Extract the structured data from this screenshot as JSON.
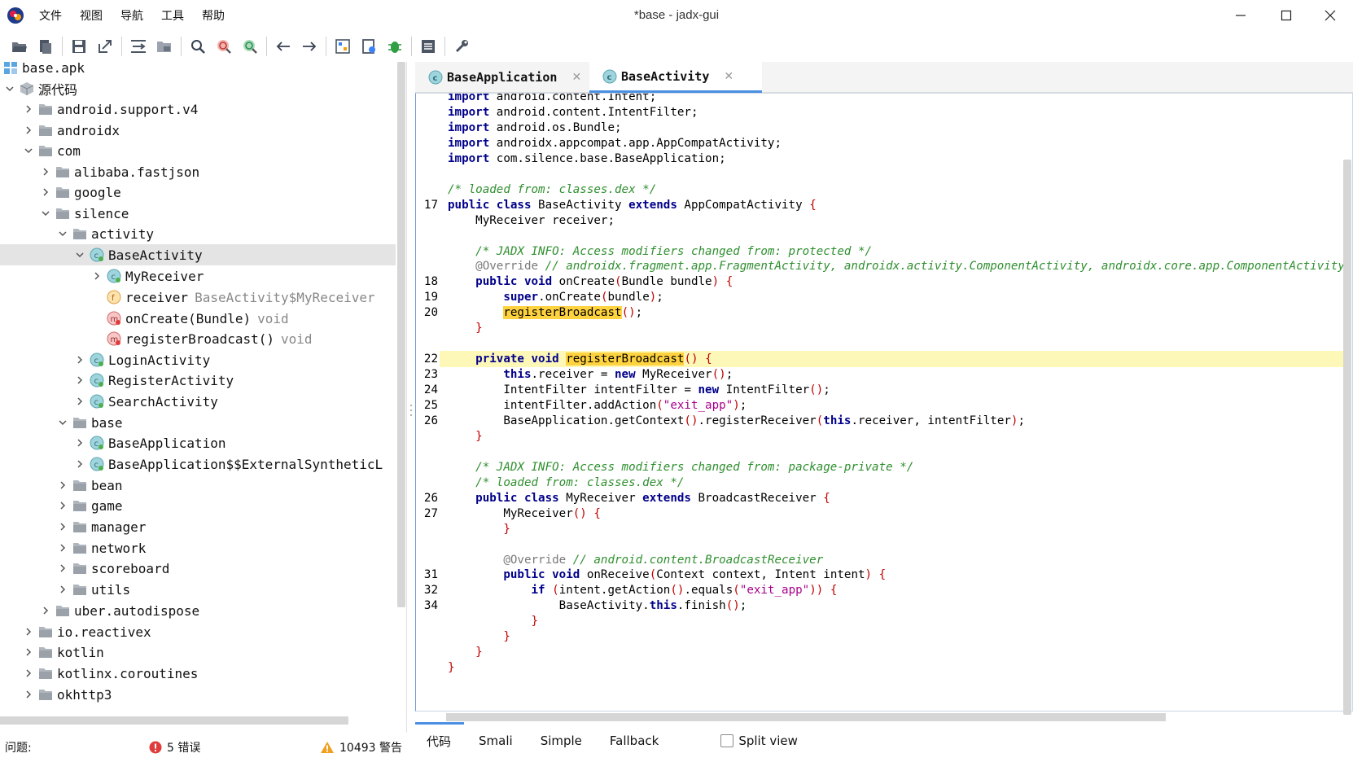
{
  "window": {
    "title": "*base - jadx-gui"
  },
  "menu": [
    "文件",
    "视图",
    "导航",
    "工具",
    "帮助"
  ],
  "toolbar_icons": [
    "open-folder-icon",
    "add-files-icon",
    "save-icon",
    "export-icon",
    "sync-tree-icon",
    "flatten-packages-icon",
    "search-icon",
    "class-search-icon",
    "usage-search-icon",
    "back-icon",
    "forward-icon",
    "deobfuscation-icon",
    "quark-icon",
    "debug-icon",
    "log-icon",
    "preferences-icon"
  ],
  "tree": {
    "rows": [
      {
        "label": "base.apk",
        "suffix": "",
        "icon": "apk",
        "level": 0,
        "chev": "none"
      },
      {
        "label": "源代码",
        "suffix": "",
        "icon": "box",
        "level": 0,
        "chev": "down"
      },
      {
        "label": "android.support.v4",
        "suffix": "",
        "icon": "folder",
        "level": 1,
        "chev": "right"
      },
      {
        "label": "androidx",
        "suffix": "",
        "icon": "folder",
        "level": 1,
        "chev": "right"
      },
      {
        "label": "com",
        "suffix": "",
        "icon": "folder",
        "level": 1,
        "chev": "down"
      },
      {
        "label": "alibaba.fastjson",
        "suffix": "",
        "icon": "folder",
        "level": 2,
        "chev": "right"
      },
      {
        "label": "google",
        "suffix": "",
        "icon": "folder",
        "level": 2,
        "chev": "right"
      },
      {
        "label": "silence",
        "suffix": "",
        "icon": "folder",
        "level": 2,
        "chev": "down"
      },
      {
        "label": "activity",
        "suffix": "",
        "icon": "folder",
        "level": 3,
        "chev": "down"
      },
      {
        "label": "BaseActivity",
        "suffix": "",
        "icon": "class",
        "level": 4,
        "chev": "down",
        "selected": true
      },
      {
        "label": "MyReceiver",
        "suffix": "",
        "icon": "class",
        "level": 5,
        "chev": "right"
      },
      {
        "label": "receiver",
        "suffix": "BaseActivity$MyReceiver",
        "icon": "field",
        "level": 5,
        "chev": "none"
      },
      {
        "label": "onCreate(Bundle)",
        "suffix": "void",
        "icon": "method",
        "level": 5,
        "chev": "none"
      },
      {
        "label": "registerBroadcast()",
        "suffix": "void",
        "icon": "method",
        "level": 5,
        "chev": "none"
      },
      {
        "label": "LoginActivity",
        "suffix": "",
        "icon": "class",
        "level": 4,
        "chev": "right"
      },
      {
        "label": "RegisterActivity",
        "suffix": "",
        "icon": "class",
        "level": 4,
        "chev": "right"
      },
      {
        "label": "SearchActivity",
        "suffix": "",
        "icon": "class",
        "level": 4,
        "chev": "right"
      },
      {
        "label": "base",
        "suffix": "",
        "icon": "folder",
        "level": 3,
        "chev": "down"
      },
      {
        "label": "BaseApplication",
        "suffix": "",
        "icon": "class",
        "level": 4,
        "chev": "right"
      },
      {
        "label": "BaseApplication$$ExternalSyntheticL",
        "suffix": "",
        "icon": "class",
        "level": 4,
        "chev": "right"
      },
      {
        "label": "bean",
        "suffix": "",
        "icon": "folder",
        "level": 3,
        "chev": "right"
      },
      {
        "label": "game",
        "suffix": "",
        "icon": "folder",
        "level": 3,
        "chev": "right"
      },
      {
        "label": "manager",
        "suffix": "",
        "icon": "folder",
        "level": 3,
        "chev": "right"
      },
      {
        "label": "network",
        "suffix": "",
        "icon": "folder",
        "level": 3,
        "chev": "right"
      },
      {
        "label": "scoreboard",
        "suffix": "",
        "icon": "folder",
        "level": 3,
        "chev": "right"
      },
      {
        "label": "utils",
        "suffix": "",
        "icon": "folder",
        "level": 3,
        "chev": "right"
      },
      {
        "label": "uber.autodispose",
        "suffix": "",
        "icon": "folder",
        "level": 2,
        "chev": "right"
      },
      {
        "label": "io.reactivex",
        "suffix": "",
        "icon": "folder",
        "level": 1,
        "chev": "right"
      },
      {
        "label": "kotlin",
        "suffix": "",
        "icon": "folder",
        "level": 1,
        "chev": "right"
      },
      {
        "label": "kotlinx.coroutines",
        "suffix": "",
        "icon": "folder",
        "level": 1,
        "chev": "right"
      },
      {
        "label": "okhttp3",
        "suffix": "",
        "icon": "folder",
        "level": 1,
        "chev": "right"
      }
    ]
  },
  "tabs": [
    {
      "label": "BaseApplication",
      "active": false
    },
    {
      "label": "BaseActivity",
      "active": true
    }
  ],
  "code": {
    "lines": [
      {
        "ln": "",
        "code": "<span class=\"kw\">import</span> android.content.Intent;"
      },
      {
        "ln": "",
        "code": "<span class=\"kw\">import</span> android.content.IntentFilter;"
      },
      {
        "ln": "",
        "code": "<span class=\"kw\">import</span> android.os.Bundle;"
      },
      {
        "ln": "",
        "code": "<span class=\"kw\">import</span> androidx.appcompat.app.AppCompatActivity;"
      },
      {
        "ln": "",
        "code": "<span class=\"kw\">import</span> com.silence.base.BaseApplication;"
      },
      {
        "ln": "",
        "code": ""
      },
      {
        "ln": "",
        "code": "<span class=\"cm\">/* loaded from: classes.dex */</span>"
      },
      {
        "ln": "17",
        "code": "<span class=\"kw\">public class</span> BaseActivity <span class=\"kw\">extends</span> AppCompatActivity <span class=\"br\">{</span>"
      },
      {
        "ln": "",
        "code": "    MyReceiver receiver;"
      },
      {
        "ln": "",
        "code": ""
      },
      {
        "ln": "",
        "code": "    <span class=\"cm\">/* JADX INFO: Access modifiers changed from: protected */</span>"
      },
      {
        "ln": "",
        "code": "    <span class=\"an\">@Override</span> <span class=\"cm\">// androidx.fragment.app.FragmentActivity, androidx.activity.ComponentActivity, androidx.core.app.ComponentActivity, android.app.Activity</span>"
      },
      {
        "ln": "18",
        "code": "    <span class=\"kw\">public void</span> onCreate<span class=\"br\">(</span>Bundle bundle<span class=\"br\">)</span> <span class=\"br\">{</span>"
      },
      {
        "ln": "19",
        "code": "        <span class=\"kw\">super</span>.onCreate<span class=\"br\">(</span>bundle<span class=\"br\">)</span>;"
      },
      {
        "ln": "20",
        "code": "        <span class=\"mk\">registerBroadcast</span><span class=\"br\">()</span>;"
      },
      {
        "ln": "",
        "code": "    <span class=\"br\">}</span>"
      },
      {
        "ln": "",
        "code": ""
      },
      {
        "ln": "22",
        "code": "    <span class=\"kw\">private void</span> <span class=\"mk\">registerBroadcast</span><span class=\"br\">()</span> <span class=\"br\">{</span>",
        "hl": true
      },
      {
        "ln": "23",
        "code": "        <span class=\"kw\">this</span>.receiver = <span class=\"kw\">new</span> MyReceiver<span class=\"br\">()</span>;"
      },
      {
        "ln": "24",
        "code": "        IntentFilter intentFilter = <span class=\"kw\">new</span> IntentFilter<span class=\"br\">()</span>;"
      },
      {
        "ln": "25",
        "code": "        intentFilter.addAction<span class=\"br\">(</span><span class=\"st\">\"exit_app\"</span><span class=\"br\">)</span>;"
      },
      {
        "ln": "26",
        "code": "        BaseApplication.getContext<span class=\"br\">()</span>.registerReceiver<span class=\"br\">(</span><span class=\"kw\">this</span>.receiver, intentFilter<span class=\"br\">)</span>;"
      },
      {
        "ln": "",
        "code": "    <span class=\"br\">}</span>"
      },
      {
        "ln": "",
        "code": ""
      },
      {
        "ln": "",
        "code": "    <span class=\"cm\">/* JADX INFO: Access modifiers changed from: package-private */</span>"
      },
      {
        "ln": "",
        "code": "    <span class=\"cm\">/* loaded from: classes.dex */</span>"
      },
      {
        "ln": "26",
        "code": "    <span class=\"kw\">public class</span> MyReceiver <span class=\"kw\">extends</span> BroadcastReceiver <span class=\"br\">{</span>"
      },
      {
        "ln": "27",
        "code": "        MyReceiver<span class=\"br\">()</span> <span class=\"br\">{</span>"
      },
      {
        "ln": "",
        "code": "        <span class=\"br\">}</span>"
      },
      {
        "ln": "",
        "code": ""
      },
      {
        "ln": "",
        "code": "        <span class=\"an\">@Override</span> <span class=\"cm\">// android.content.BroadcastReceiver</span>"
      },
      {
        "ln": "31",
        "code": "        <span class=\"kw\">public void</span> onReceive<span class=\"br\">(</span>Context context, Intent intent<span class=\"br\">)</span> <span class=\"br\">{</span>"
      },
      {
        "ln": "32",
        "code": "            <span class=\"kw\">if</span> <span class=\"br\">(</span>intent.getAction<span class=\"br\">()</span>.equals<span class=\"br\">(</span><span class=\"st\">\"exit_app\"</span><span class=\"br\">))</span> <span class=\"br\">{</span>"
      },
      {
        "ln": "34",
        "code": "                BaseActivity.<span class=\"kw\">this</span>.finish<span class=\"br\">()</span>;"
      },
      {
        "ln": "",
        "code": "            <span class=\"br\">}</span>"
      },
      {
        "ln": "",
        "code": "        <span class=\"br\">}</span>"
      },
      {
        "ln": "",
        "code": "    <span class=\"br\">}</span>"
      },
      {
        "ln": "",
        "code": "<span class=\"br\">}</span>"
      }
    ]
  },
  "mode_tabs": [
    "代码",
    "Smali",
    "Simple",
    "Fallback"
  ],
  "split_view": {
    "label": "Split view",
    "checked": false
  },
  "status": {
    "issues_label": "问题:",
    "errors": "5 错误",
    "warnings": "10493 警告"
  },
  "colors": {
    "keyword": "#00008b",
    "comment": "#2f8f2f",
    "string": "#a7008b",
    "highlight_line": "#fdf7b8",
    "marked_word": "#ffd23f",
    "tab_underline": "#4a90e2"
  }
}
